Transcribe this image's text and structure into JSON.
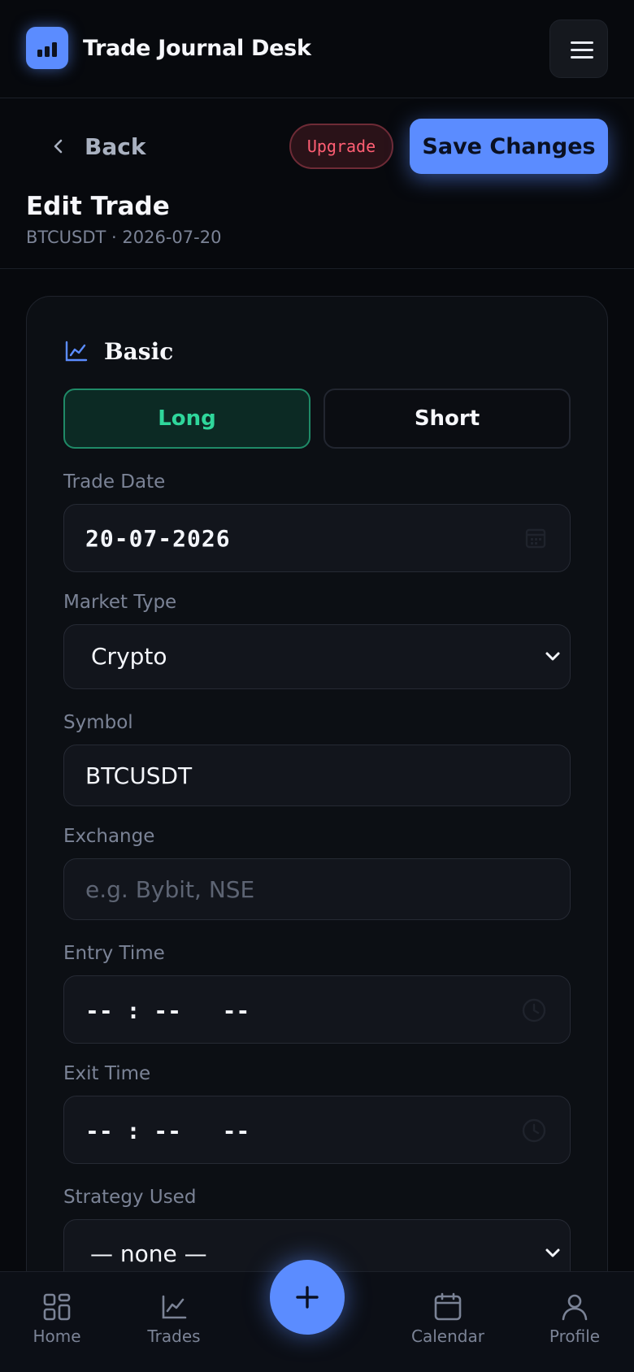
{
  "app": {
    "title": "Trade Journal Desk"
  },
  "header": {
    "back_label": "Back",
    "upgrade_label": "Upgrade",
    "save_label": "Save Changes",
    "page_title": "Edit Trade",
    "subtitle": "BTCUSDT · 2026-07-20"
  },
  "form": {
    "section_title": "Basic",
    "direction": {
      "options": [
        "Long",
        "Short"
      ],
      "selected": "Long"
    },
    "trade_date": {
      "label": "Trade Date",
      "value": "20-07-2026"
    },
    "market_type": {
      "label": "Market Type",
      "value": "Crypto"
    },
    "symbol": {
      "label": "Symbol",
      "value": "BTCUSDT"
    },
    "exchange": {
      "label": "Exchange",
      "value": "",
      "placeholder": "e.g. Bybit, NSE"
    },
    "entry_time": {
      "label": "Entry Time",
      "value": "-- : --   --"
    },
    "exit_time": {
      "label": "Exit Time",
      "value": "-- : --   --"
    },
    "strategy": {
      "label": "Strategy Used",
      "value": "— none —"
    }
  },
  "nav": {
    "items": [
      {
        "label": "Home",
        "icon": "grid-icon"
      },
      {
        "label": "Trades",
        "icon": "chart-line-icon"
      },
      {
        "label": "Calendar",
        "icon": "calendar-icon"
      },
      {
        "label": "Profile",
        "icon": "user-icon"
      }
    ],
    "fab_icon": "plus-icon"
  },
  "colors": {
    "accent": "#5b8cff",
    "long_green": "#2fd69b",
    "upgrade_red": "#ff5e73",
    "background": "#07090d"
  }
}
